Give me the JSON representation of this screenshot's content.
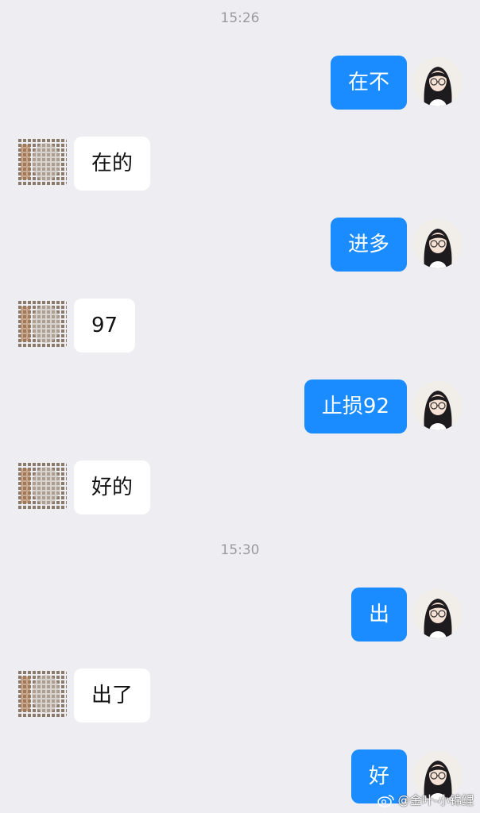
{
  "timestamps": [
    "15:26",
    "15:30"
  ],
  "messages": [
    {
      "side": "out",
      "text": "在不"
    },
    {
      "side": "in",
      "text": "在的"
    },
    {
      "side": "out",
      "text": "进多"
    },
    {
      "side": "in",
      "text": "97"
    },
    {
      "side": "out",
      "text": "止损92"
    },
    {
      "side": "in",
      "text": "好的"
    },
    {
      "side": "out",
      "text": "出"
    },
    {
      "side": "in",
      "text": "出了"
    },
    {
      "side": "out",
      "text": "好"
    }
  ],
  "watermark": "@金叶-小锦鲤",
  "colors": {
    "background": "#EDEDF2",
    "outgoing_bubble": "#1A8CFF",
    "incoming_bubble": "#FFFFFF",
    "timestamp_text": "#9A9AA0"
  },
  "icons": {
    "my_avatar": "anime-girl-avatar",
    "other_avatar": "pixelated-avatar",
    "watermark_logo": "weibo-logo-icon"
  }
}
